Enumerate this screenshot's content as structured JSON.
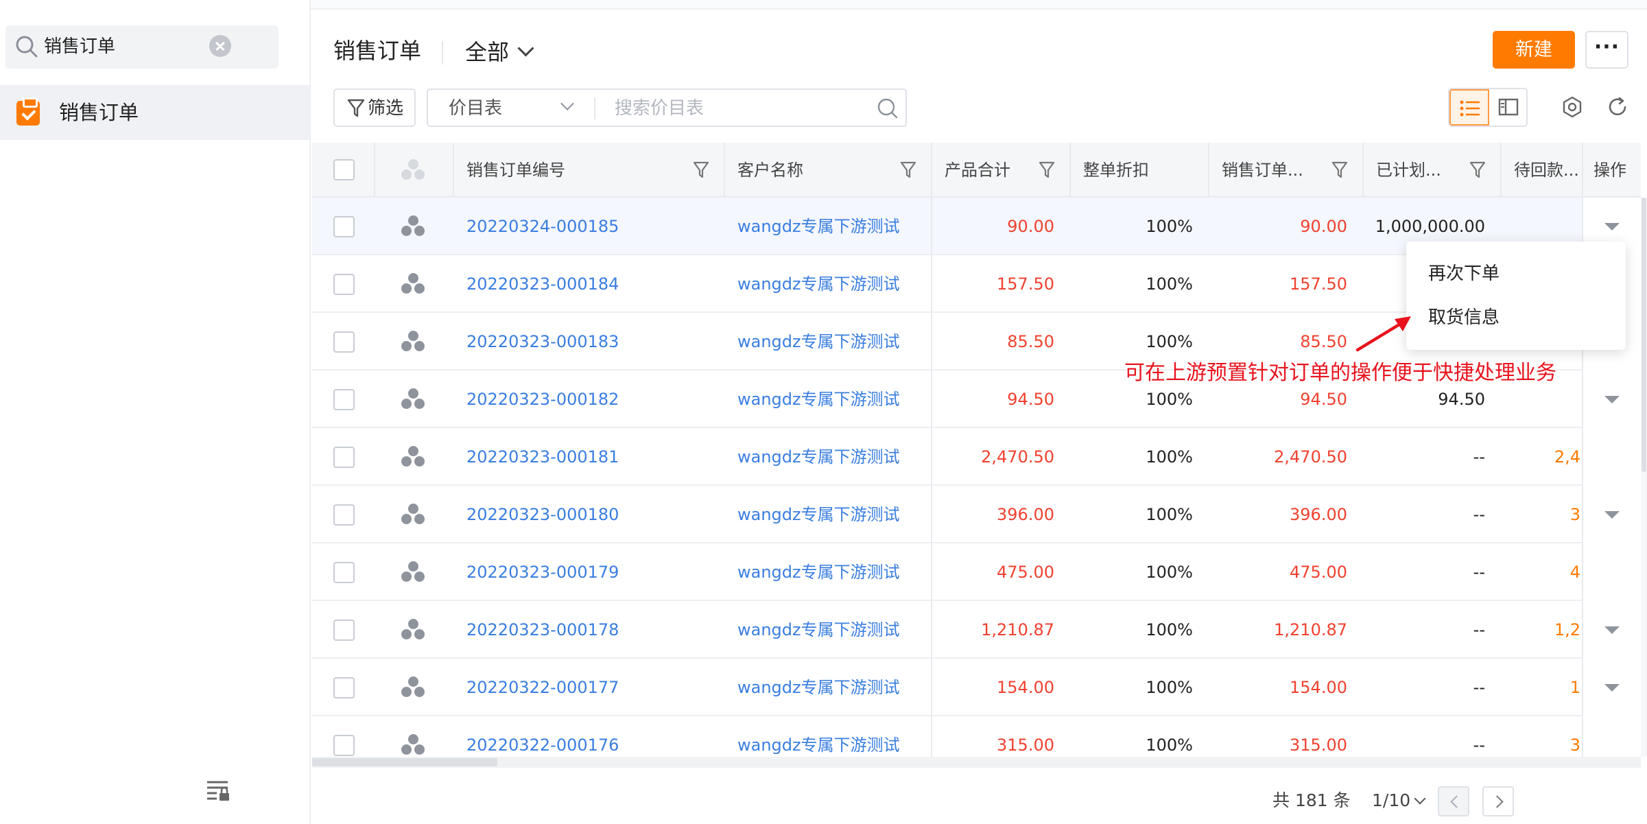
{
  "sidebar": {
    "search_value": "销售订单",
    "items": [
      {
        "label": "销售订单",
        "icon": "clipboard-check-icon"
      }
    ],
    "bottom_icon": "list-settings-lock-icon"
  },
  "header": {
    "title": "销售订单",
    "view_label": "全部",
    "new_button": "新建",
    "more_button": "···"
  },
  "toolbar": {
    "filter_label": "筛选",
    "price_list_label": "价目表",
    "search_placeholder": "搜索价目表",
    "active_view": "list"
  },
  "table": {
    "columns": [
      {
        "key": "order_no",
        "label": "销售订单编号",
        "filter": true
      },
      {
        "key": "customer",
        "label": "客户名称",
        "filter": true
      },
      {
        "key": "product_total",
        "label": "产品合计",
        "filter": true
      },
      {
        "key": "discount",
        "label": "整单折扣",
        "filter": false
      },
      {
        "key": "order_amount",
        "label": "销售订单...",
        "filter": true
      },
      {
        "key": "planned",
        "label": "已计划...",
        "filter": true
      },
      {
        "key": "pending",
        "label": "待回款...",
        "filter": false
      },
      {
        "key": "ops",
        "label": "操作",
        "filter": false
      }
    ],
    "rows": [
      {
        "order_no": "20220324-000185",
        "customer": "wangdz专属下游测试",
        "product_total": "90.00",
        "discount": "100%",
        "order_amount": "90.00",
        "planned": "1,000,000.00",
        "pending": "",
        "has_menu": true,
        "highlighted": true
      },
      {
        "order_no": "20220323-000184",
        "customer": "wangdz专属下游测试",
        "product_total": "157.50",
        "discount": "100%",
        "order_amount": "157.50",
        "planned": "",
        "pending": "",
        "has_menu": false
      },
      {
        "order_no": "20220323-000183",
        "customer": "wangdz专属下游测试",
        "product_total": "85.50",
        "discount": "100%",
        "order_amount": "85.50",
        "planned": "",
        "pending": "",
        "has_menu": false
      },
      {
        "order_no": "20220323-000182",
        "customer": "wangdz专属下游测试",
        "product_total": "94.50",
        "discount": "100%",
        "order_amount": "94.50",
        "planned": "94.50",
        "pending": "",
        "has_menu": true
      },
      {
        "order_no": "20220323-000181",
        "customer": "wangdz专属下游测试",
        "product_total": "2,470.50",
        "discount": "100%",
        "order_amount": "2,470.50",
        "planned": "--",
        "pending": "2,4",
        "has_menu": false
      },
      {
        "order_no": "20220323-000180",
        "customer": "wangdz专属下游测试",
        "product_total": "396.00",
        "discount": "100%",
        "order_amount": "396.00",
        "planned": "--",
        "pending": "3",
        "has_menu": true
      },
      {
        "order_no": "20220323-000179",
        "customer": "wangdz专属下游测试",
        "product_total": "475.00",
        "discount": "100%",
        "order_amount": "475.00",
        "planned": "--",
        "pending": "4",
        "has_menu": false
      },
      {
        "order_no": "20220323-000178",
        "customer": "wangdz专属下游测试",
        "product_total": "1,210.87",
        "discount": "100%",
        "order_amount": "1,210.87",
        "planned": "--",
        "pending": "1,2",
        "has_menu": true
      },
      {
        "order_no": "20220322-000177",
        "customer": "wangdz专属下游测试",
        "product_total": "154.00",
        "discount": "100%",
        "order_amount": "154.00",
        "planned": "--",
        "pending": "1",
        "has_menu": true
      },
      {
        "order_no": "20220322-000176",
        "customer": "wangdz专属下游测试",
        "product_total": "315.00",
        "discount": "100%",
        "order_amount": "315.00",
        "planned": "--",
        "pending": "3",
        "has_menu": false
      }
    ]
  },
  "row_menu": {
    "items": [
      "再次下单",
      "取货信息"
    ]
  },
  "annotation": {
    "text": "可在上游预置针对订单的操作便于快捷处理业务",
    "color": "#e8131d"
  },
  "pagination": {
    "total_label": "共 181 条",
    "page_label": "1/10"
  },
  "colors": {
    "accent": "#ff7a00",
    "link": "#3a7ee0",
    "amount": "#f0412f"
  }
}
